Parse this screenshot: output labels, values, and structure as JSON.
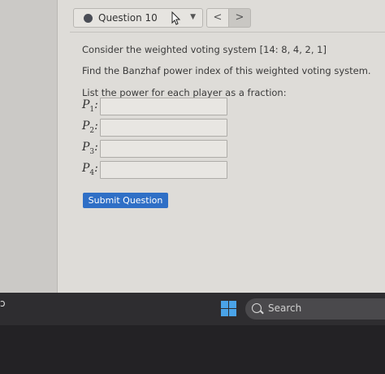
{
  "header": {
    "question_label": "Question 10",
    "prev_label": "<",
    "next_label": ">"
  },
  "question": {
    "prompt": "Consider the weighted voting system [14: 8, 4, 2, 1]",
    "task": "Find the Banzhaf power index of this weighted voting system.",
    "instruction": "List the power for each player as a fraction:",
    "players": [
      {
        "name": "P",
        "sub": "1",
        "value": ""
      },
      {
        "name": "P",
        "sub": "2",
        "value": ""
      },
      {
        "name": "P",
        "sub": "3",
        "value": ""
      },
      {
        "name": "P",
        "sub": "4",
        "value": ""
      }
    ]
  },
  "submit_label": "Submit Question",
  "taskbar": {
    "search_placeholder": "Search"
  },
  "colors": {
    "accent": "#2f6fc6",
    "windows_logo": "#4aa3e8"
  }
}
